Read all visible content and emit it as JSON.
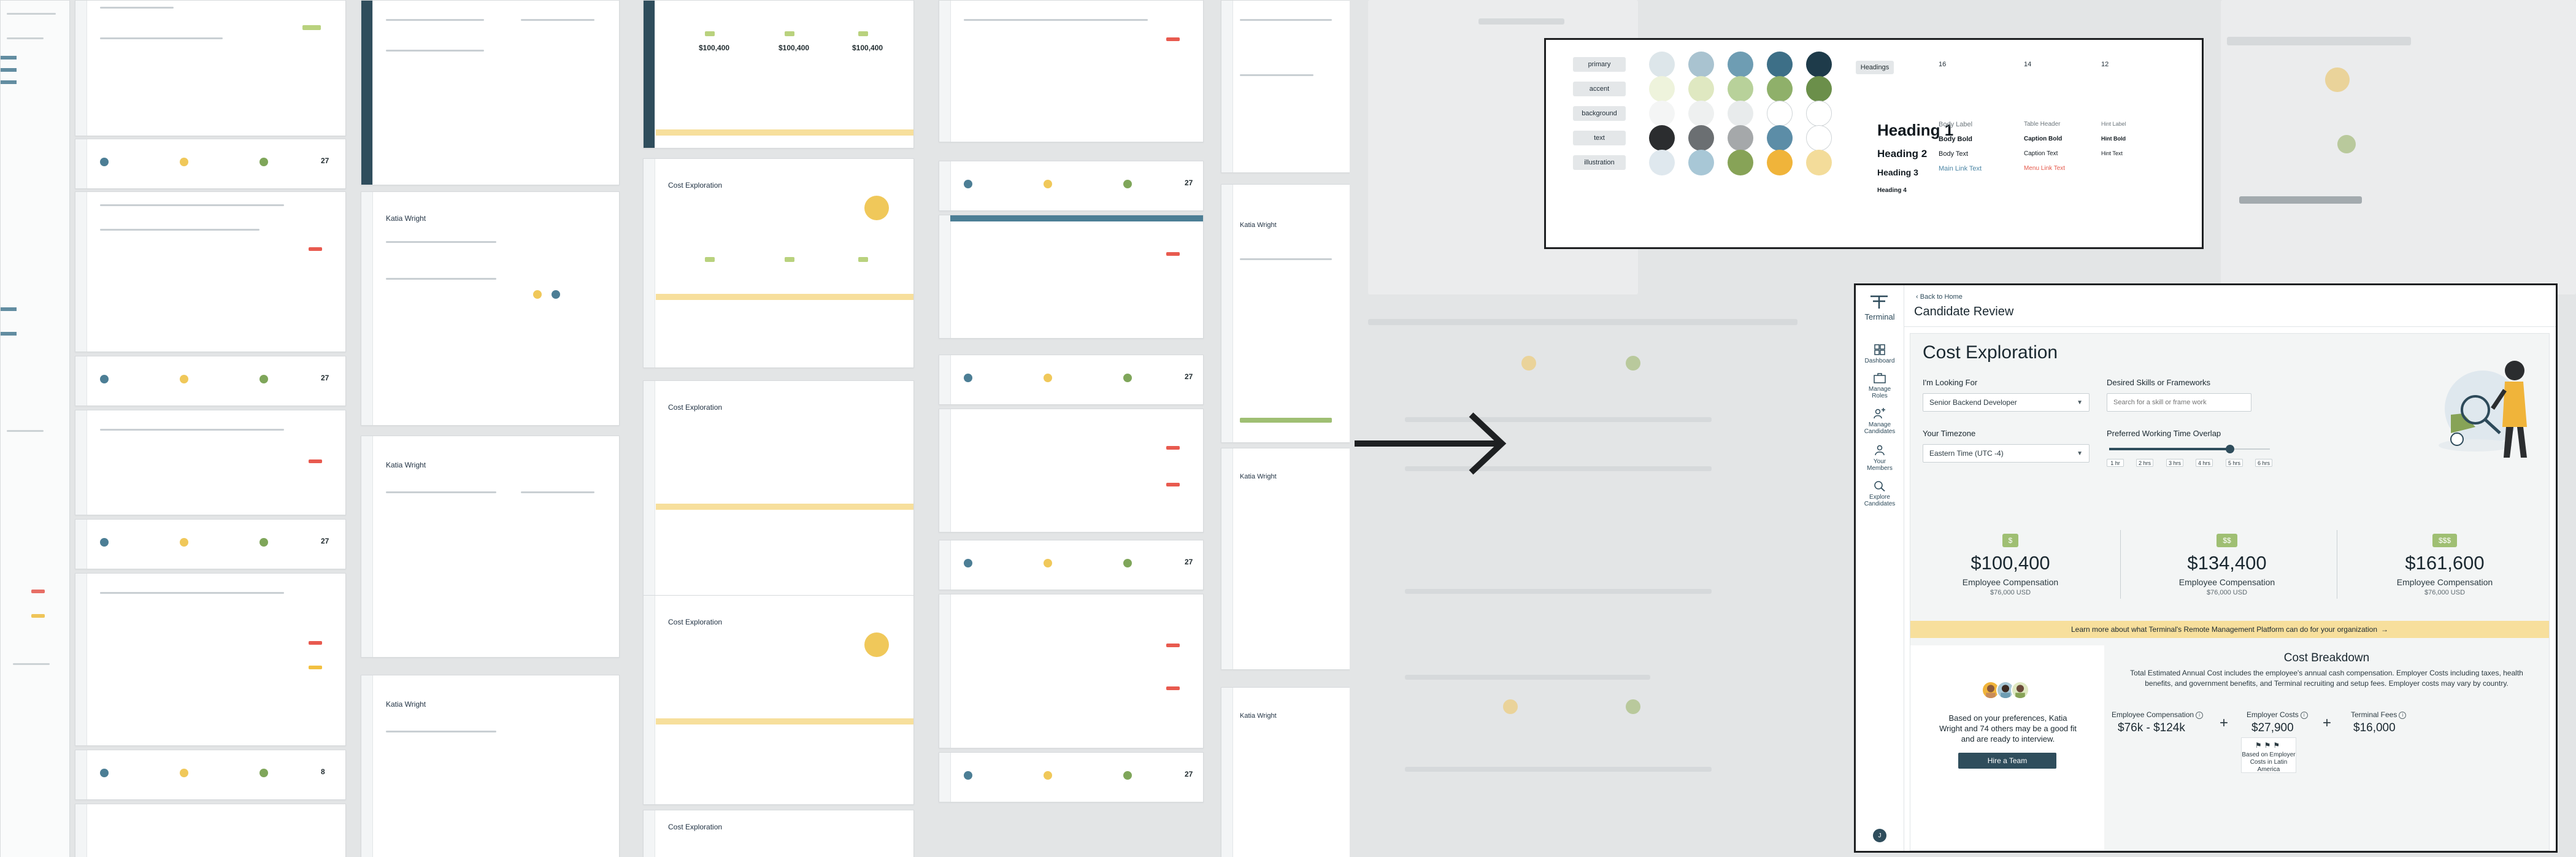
{
  "style_guide": {
    "color_rows": [
      {
        "label": "primary",
        "swatches": [
          "#dde6ea",
          "#a9c3d0",
          "#6e9db3",
          "#3d6f87",
          "#1e3b4a"
        ]
      },
      {
        "label": "accent",
        "swatches": [
          "#eef3dc",
          "#dfe8c1",
          "#b8d19a",
          "#8fb06a",
          "#6b8f4a"
        ]
      },
      {
        "label": "background",
        "swatches": [
          "#f4f5f5",
          "#eef0f0",
          "#e8ebec",
          "#ffffff",
          "#ffffff"
        ]
      },
      {
        "label": "text",
        "swatches": [
          "#2b2d2f",
          "#6b6f72",
          "#a5a8aa",
          "#5c8da7",
          "#ffffff"
        ]
      },
      {
        "label": "illustration",
        "swatches": [
          "#dfe8ee",
          "#a8c7d6",
          "#87a357",
          "#f0b43a",
          "#f3dc9a"
        ]
      }
    ],
    "headings_label": "Headings",
    "sizes": [
      "16",
      "14",
      "12"
    ],
    "heading1": "Heading 1",
    "heading2": "Heading 2",
    "heading3": "Heading 3",
    "heading4": "Heading 4",
    "col16": [
      "Body Label",
      "Body Bold",
      "Body Text",
      "Main Link Text"
    ],
    "col14": [
      "Table Header",
      "Caption Bold",
      "Caption Text",
      "Menu Link Text"
    ],
    "col12": [
      "Hint Label",
      "Hint Bold",
      "Hint Text"
    ]
  },
  "app": {
    "brand": "Terminal",
    "nav": [
      {
        "label": "Dashboard",
        "icon": "dashboard-icon"
      },
      {
        "label": "Manage Roles",
        "icon": "briefcase-icon"
      },
      {
        "label": "Manage Candidates",
        "icon": "candidates-icon"
      },
      {
        "label": "Your Members",
        "icon": "members-icon"
      },
      {
        "label": "Explore Candidates",
        "icon": "explore-icon"
      }
    ],
    "avatar_initial": "J",
    "back_link": "Back to Home",
    "page_title": "Candidate Review",
    "cost": {
      "title": "Cost Exploration",
      "looking_for_label": "I'm Looking For",
      "looking_for_value": "Senior Backend Developer",
      "skills_label": "Desired Skills or Frameworks",
      "skills_placeholder": "Search for a skill or frame work",
      "timezone_label": "Your Timezone",
      "timezone_value": "Eastern Time (UTC -4)",
      "overlap_label": "Preferred Working Time Overlap",
      "overlap_level": 0.75,
      "hours": [
        "1 hr",
        "2 hrs",
        "3 hrs",
        "4 hrs",
        "5 hrs",
        "6 hrs"
      ],
      "plans": [
        {
          "tag": "$",
          "price": "$100,400",
          "label": "Employee Compensation",
          "sub": "$76,000 USD"
        },
        {
          "tag": "$$",
          "price": "$134,400",
          "label": "Employee Compensation",
          "sub": "$76,000 USD"
        },
        {
          "tag": "$$$",
          "price": "$161,600",
          "label": "Employee Compensation",
          "sub": "$76,000 USD"
        }
      ],
      "learn_more": "Learn more about what Terminal's Remote Management Platform can do for your organization",
      "candidates_text": "Based on your preferences, Katia Wright and 74 others may be a good fit and are ready to interview.",
      "hire_button": "Hire a Team",
      "breakdown_title": "Cost Breakdown",
      "breakdown_desc": "Total Estimated Annual Cost includes the employee's annual cash compensation. Employer Costs including taxes, health benefits, and government benefits, and Terminal recruiting and setup fees. Employer costs may vary by country.",
      "comp_label": "Employee Compensation",
      "comp_value": "$76k - $124k",
      "employer_label": "Employer Costs",
      "employer_value": "$27,900",
      "fees_label": "Terminal Fees",
      "fees_value": "$16,000",
      "employer_note": "Based on Employer Costs in Latin America"
    }
  }
}
